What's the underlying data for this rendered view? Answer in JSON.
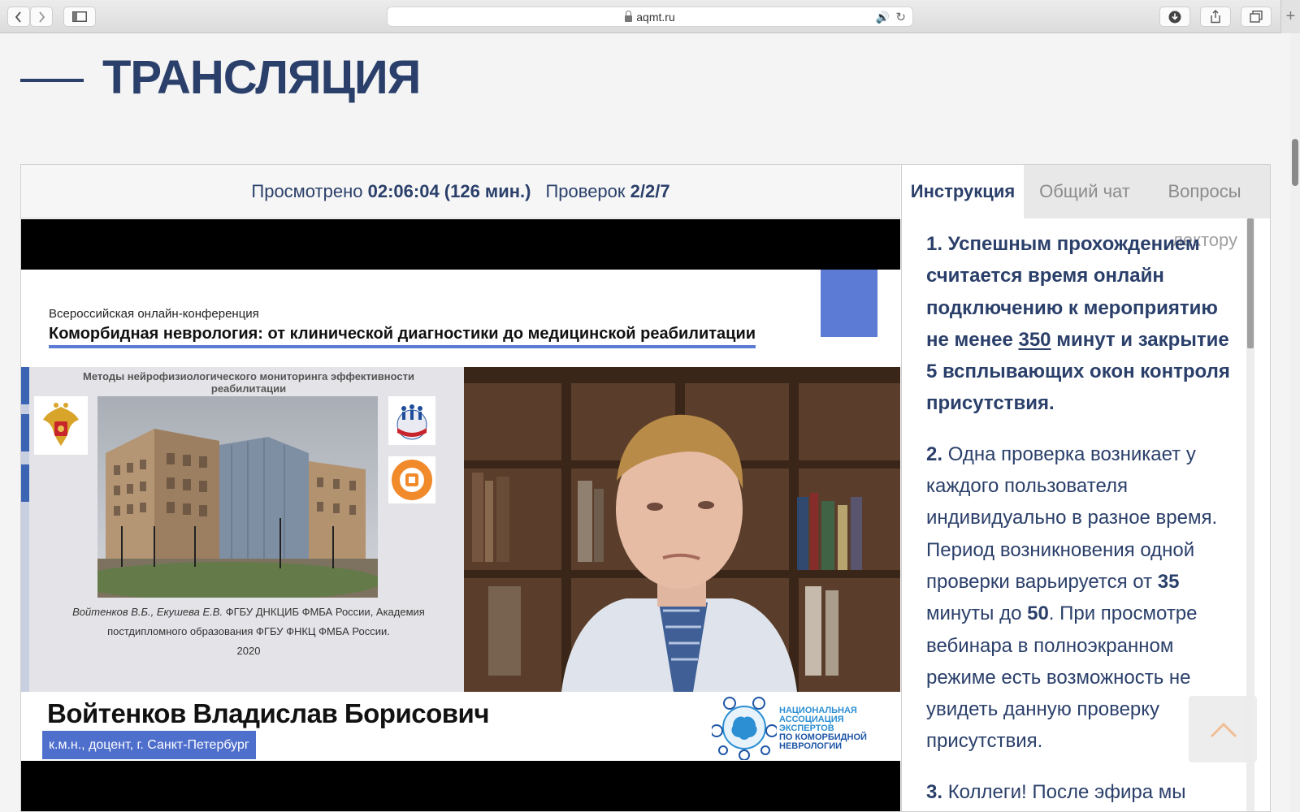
{
  "browser": {
    "url": "aqmt.ru",
    "new_tab": "+"
  },
  "page": {
    "title": "ТРАНСЛЯЦИЯ"
  },
  "stats": {
    "viewed_label": "Просмотрено",
    "viewed_value": "02:06:04 (126 мин.)",
    "checks_label": "Проверок",
    "checks_value": "2/2/7"
  },
  "video": {
    "conference_subtitle": "Всероссийская онлайн-конференция",
    "conference_title": "Коморбидная неврология: от клинической диагностики до медицинской реабилитации",
    "slide_heading": "Методы нейрофизиологического мониторинга эффективности реабилитации",
    "slide_authors": "Войтенков В.Б., Екушева Е.В.",
    "slide_org_1": "ФГБУ ДНКЦИБ ФМБА России, Академия",
    "slide_org_2": "постдипломного образования ФГБУ ФНКЦ ФМБА России.",
    "slide_year": "2020",
    "speaker_name": "Войтенков Владислав Борисович",
    "speaker_role": "к.м.н., доцент, г. Санкт-Петербург",
    "association_line1": "НАЦИОНАЛЬНАЯ",
    "association_line2": "АССОЦИАЦИЯ",
    "association_line3": "ЭКСПЕРТОВ",
    "association_line4": "ПО КОМОРБИДНОЙ",
    "association_line5": "НЕВРОЛОГИИ"
  },
  "sidebar": {
    "tabs": [
      {
        "label": "Инструкция",
        "active": true
      },
      {
        "label": "Общий чат",
        "active": false
      },
      {
        "label": "Вопросы",
        "active": false
      }
    ],
    "ghost_text": "лектору",
    "item1_number": "1.",
    "item1_text_a": "Успешным прохождением считается время онлайн подключению к мероприятию не менее",
    "item1_minutes": "350",
    "item1_text_b": "минут и закрытие 5 всплывающих окон контроля присутствия.",
    "item2_number": "2.",
    "item2_text_a": "Одна проверка возникает у каждого пользователя индивидуально в разное время. Период возникновения одной проверки варьируется от",
    "item2_min": "35",
    "item2_text_b": "минуты до",
    "item2_max": "50",
    "item2_text_c": ". При просмотре вебинара в полноэкранном режиме есть возможность не увидеть данную проверку присутствия.",
    "item3_number": "3.",
    "item3_text": "Коллеги! После эфира мы"
  },
  "colors": {
    "primary": "#2a3f6a",
    "accent": "#5b7bd5",
    "role_badge": "#4f6fcc"
  }
}
